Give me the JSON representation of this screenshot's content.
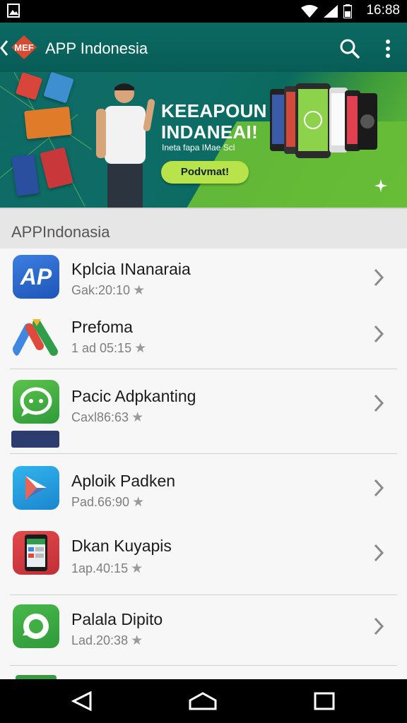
{
  "status_bar": {
    "time": "16:88"
  },
  "app_bar": {
    "title": "APP Indonesia",
    "logo_text": "MEF"
  },
  "banner": {
    "headline_line1": "KEEAPOUN",
    "headline_line2": "INDANEAI!",
    "subtext": "Ineta fapa IMae Scl",
    "cta_label": "Podvmat!"
  },
  "section": {
    "title": "APPIndonasia"
  },
  "apps": [
    {
      "name": "Kplcia INanaraia",
      "meta": "Gak:20:10",
      "icon": "ap-logo-icon"
    },
    {
      "name": "Prefoma",
      "meta": "1 ad 05:15",
      "icon": "google-ads-logo-icon"
    },
    {
      "name": "Pacic Adpkanting",
      "meta": "Caxl86:63",
      "icon": "chat-bubble-icon"
    },
    {
      "name": "Aploik Padken",
      "meta": "Pad.66:90",
      "icon": "play-store-icon"
    },
    {
      "name": "Dkan Kuyapis",
      "meta": "1ap.40:15",
      "icon": "phone-screen-icon"
    },
    {
      "name": "Palala Dipito",
      "meta": "Lad.20:38",
      "icon": "green-ring-icon"
    }
  ],
  "colors": {
    "app_bar": "#0b6a63",
    "banner_green": "#67bd36",
    "cta": "#b9e34a"
  }
}
